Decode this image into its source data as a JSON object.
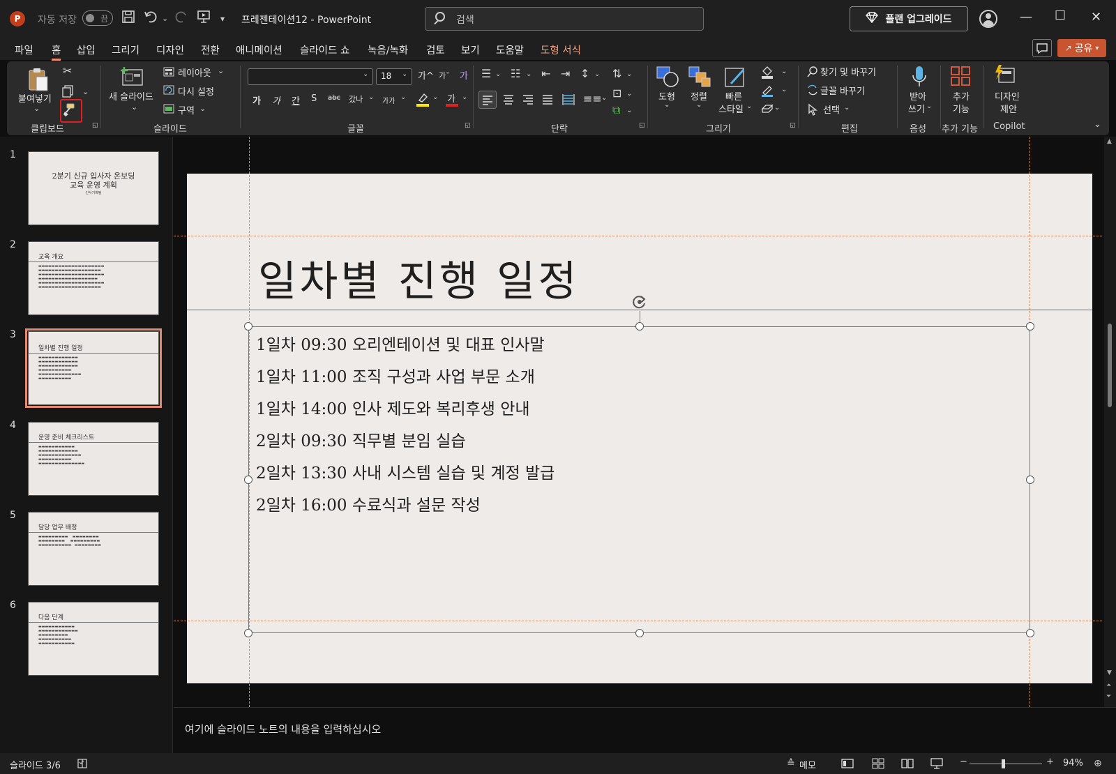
{
  "titlebar": {
    "app_logo": "P",
    "autosave_label": "자동 저장",
    "autosave_state": "끔",
    "doc_title": "프레젠테이션12  -  PowerPoint",
    "search_placeholder": "검색",
    "upgrade_label": "플랜 업그레이드",
    "icons": [
      "save-icon",
      "undo-icon",
      "redo-icon",
      "present-icon",
      "customize-qat-icon"
    ]
  },
  "tabs": [
    "파일",
    "홈",
    "삽입",
    "그리기",
    "디자인",
    "전환",
    "애니메이션",
    "슬라이드 쇼",
    "녹음/녹화",
    "검토",
    "보기",
    "도움말",
    "도형 서식"
  ],
  "active_tab": "홈",
  "share_label": "공유",
  "ribbon": {
    "clipboard": {
      "paste": "붙여넣기",
      "label": "클립보드"
    },
    "slides": {
      "new_slide_1": "새",
      "new_slide_2": "슬라이드",
      "layout": "레이아웃",
      "reset": "다시 설정",
      "section": "구역",
      "label": "슬라이드"
    },
    "font": {
      "font_name": "",
      "font_size": "18",
      "label": "글꼴",
      "bold": "가",
      "italic": "가",
      "underline": "간",
      "shadow": "S",
      "strike": "abc",
      "spacing": "갔나",
      "case": "가가"
    },
    "paragraph": {
      "label": "단락"
    },
    "drawing": {
      "shape": "도형",
      "arrange": "정렬",
      "quick_style_1": "빠른",
      "quick_style_2": "스타일",
      "label": "그리기"
    },
    "editing": {
      "find": "찾기 및 바꾸기",
      "replace_font": "글꼴 바꾸기",
      "select": "선택",
      "label": "편집"
    },
    "voice": {
      "dictate_1": "받아",
      "dictate_2": "쓰기",
      "label": "음성"
    },
    "addins": {
      "addin_1": "추가",
      "addin_2": "기능",
      "label": "추가 기능"
    },
    "copilot": {
      "designer_1": "디자인",
      "designer_2": "제안",
      "label": "Copilot"
    }
  },
  "slides_panel": [
    {
      "num": "1",
      "title_1": "2분기 신규 입사자 온보딩",
      "title_2": "교육 운영 계획",
      "subtitle": "인사기획팀"
    },
    {
      "num": "2",
      "title": "교육 개요"
    },
    {
      "num": "3",
      "title": "일차별 진행 일정"
    },
    {
      "num": "4",
      "title": "운영 준비 체크리스트"
    },
    {
      "num": "5",
      "title": "담당 업무 배정"
    },
    {
      "num": "6",
      "title": "다음 단계"
    }
  ],
  "slide": {
    "title": "일차별 진행 일정",
    "body": [
      "1일차 09:30 오리엔테이션 및 대표 인사말",
      "1일차 11:00 조직 구성과 사업 부문 소개",
      "1일차 14:00 인사 제도와 복리후생 안내",
      "2일차 09:30 직무별 분임 실습",
      "2일차 13:30 사내 시스템 실습 및 계정 발급",
      "2일차 16:00 수료식과 설문 작성"
    ]
  },
  "notes_placeholder": "여기에 슬라이드 노트의 내용을 입력하십시오",
  "status": {
    "slide_indicator": "슬라이드 3/6",
    "notes_label": "메모",
    "zoom": "94%"
  },
  "colors": {
    "accent": "#e58a6f",
    "brand": "#c43e1c",
    "highlight": "#e02020"
  }
}
